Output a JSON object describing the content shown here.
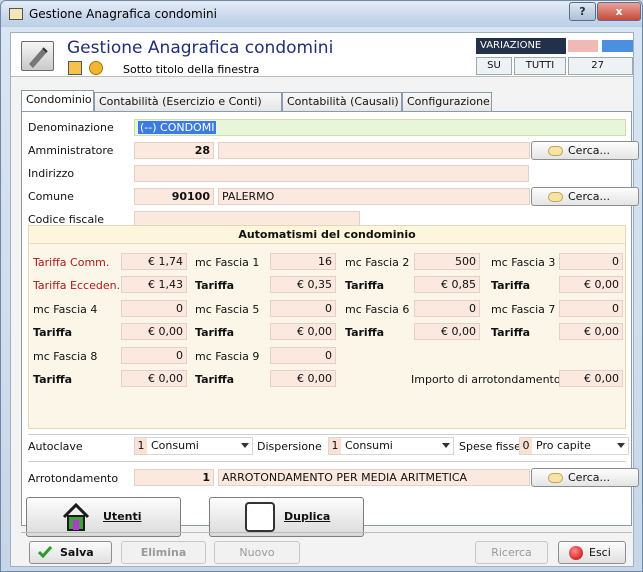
{
  "window": {
    "title": "Gestione Anagrafica condomini",
    "help": "?",
    "close": "x"
  },
  "header": {
    "title": "Gestione Anagrafica condomini",
    "subtitle": "Sotto titolo della finestra",
    "mode_label": "VARIAZIONE",
    "su": "SU",
    "tutti": "TUTTI",
    "count": "27"
  },
  "tabs": [
    {
      "label": "Condominio"
    },
    {
      "label": "Contabilità (Esercizio e Conti)"
    },
    {
      "label": "Contabilità (Causali)"
    },
    {
      "label": "Configurazione"
    }
  ],
  "form": {
    "denominazione_label": "Denominazione",
    "denominazione_value": "(--) CONDOMI",
    "amministratore_label": "Amministratore",
    "amministratore_code": "28",
    "indirizzo_label": "Indirizzo",
    "comune_label": "Comune",
    "comune_code": "90100",
    "comune_name": "PALERMO",
    "codice_fiscale_label": "Codice fiscale",
    "cerca": "Cerca..."
  },
  "auto": {
    "title": "Automatismi del condominio",
    "tariffa_comm_label": "Tariffa Comm.",
    "tariffa_comm_value": "€ 1,74",
    "tariffa_ecceden_label": "Tariffa Ecceden.",
    "tariffa_ecceden_value": "€ 1,43",
    "mc1_label": "mc Fascia 1",
    "mc1": "16",
    "mc2_label": "mc Fascia 2",
    "mc2": "500",
    "mc3_label": "mc Fascia 3",
    "mc3": "0",
    "mc4_label": "mc Fascia 4",
    "mc4": "0",
    "mc5_label": "mc Fascia 5",
    "mc5": "0",
    "mc6_label": "mc Fascia 6",
    "mc6": "0",
    "mc7_label": "mc Fascia 7",
    "mc7": "0",
    "mc8_label": "mc Fascia 8",
    "mc8": "0",
    "mc9_label": "mc Fascia 9",
    "mc9": "0",
    "tariffa_label": "Tariffa",
    "t1": "€ 0,35",
    "t2": "€ 0,85",
    "t3": "€ 0,00",
    "t4": "€ 0,00",
    "t5": "€ 0,00",
    "t6": "€ 0,00",
    "t7": "€ 0,00",
    "t8": "€ 0,00",
    "t9": "€ 0,00",
    "importo_label": "Importo di arrotondamento",
    "importo_value": "€ 0,00"
  },
  "bottom": {
    "autoclave_label": "Autoclave",
    "autoclave_code": "1",
    "autoclave_value": "Consumi",
    "dispersione_label": "Dispersione",
    "dispersione_code": "1",
    "dispersione_value": "Consumi",
    "spese_label": "Spese fisse",
    "spese_code": "0",
    "spese_value": "Pro capite",
    "arrot_label": "Arrotondamento",
    "arrot_code": "1",
    "arrot_value": "ARROTONDAMENTO PER MEDIA ARITMETICA"
  },
  "actions": {
    "utenti": "Utenti",
    "duplica": "Duplica"
  },
  "footer": {
    "salva": "Salva",
    "elimina": "Elimina",
    "nuovo": "Nuovo",
    "ricerca": "Ricerca",
    "esci": "Esci"
  }
}
